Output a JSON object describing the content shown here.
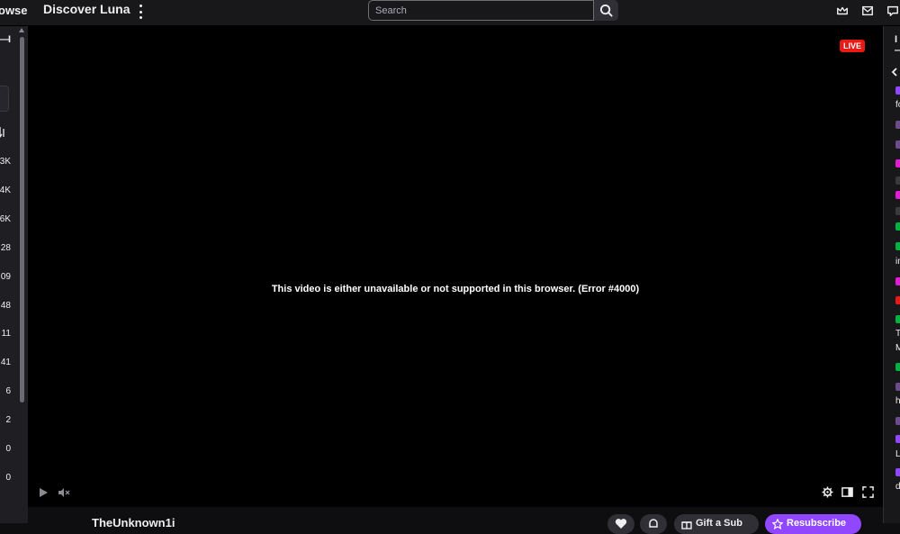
{
  "topnav": {
    "browse": "owse",
    "discover": "Discover Luna",
    "search_placeholder": "Search"
  },
  "sidebar": {
    "collapse_glyph": "I—I",
    "counts": [
      "3K",
      "4K",
      "6K",
      "28",
      "09",
      "48",
      "11",
      "41",
      "6",
      "2",
      "0",
      "0"
    ]
  },
  "player": {
    "live_badge": "LIVE",
    "error_message": "This video is either unavailable or not supported in this browser. (Error #4000)"
  },
  "channel": {
    "name": "TheUnknown1i",
    "gift_label": "Gift a Sub",
    "resubscribe_label": "Resubscribe"
  },
  "chat": {
    "header_glyph": "I—",
    "text_fragments": [
      "fo",
      "in",
      "T",
      "M",
      "h",
      "L",
      "d"
    ]
  },
  "colors": {
    "accent": "#9147ff",
    "live": "#e91916",
    "background": "#0e0e10"
  }
}
